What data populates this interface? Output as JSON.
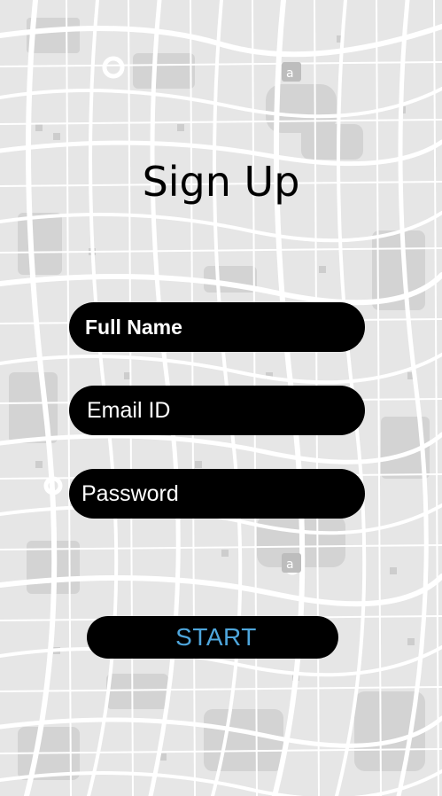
{
  "title": "Sign Up",
  "form": {
    "full_name": {
      "value": "",
      "placeholder": "Full Name"
    },
    "email": {
      "value": "",
      "placeholder": "Email ID"
    },
    "password": {
      "value": "",
      "placeholder": "Password"
    }
  },
  "start_label": "START",
  "colors": {
    "field_background": "#000000",
    "field_text": "#ffffff",
    "start_text": "#4ea6dc",
    "map_background": "#e9e9e9",
    "map_roads": "#ffffff",
    "map_blocks": "#d6d6d6"
  }
}
